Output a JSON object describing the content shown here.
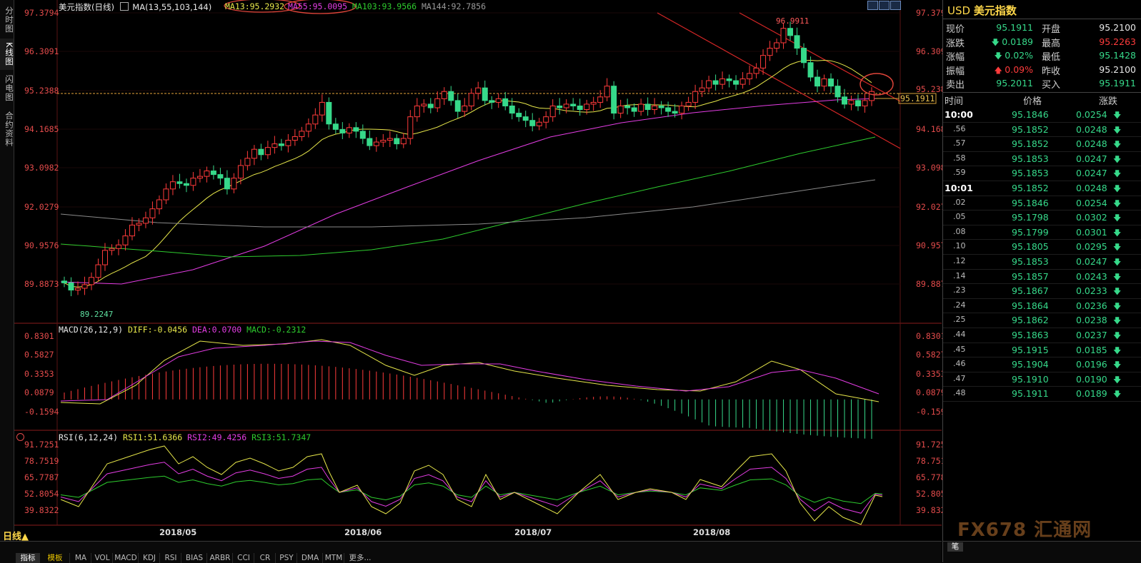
{
  "left_tabs": [
    "分时图",
    "K线图",
    "闪电图",
    "合约资料"
  ],
  "header": {
    "title": "美元指数(日线)",
    "ma_label": "MA(13,55,103,144)",
    "ma13": "MA13:95.2932",
    "ma55": "MA55:95.0095",
    "ma103": "MA103:93.9566",
    "ma144": "MA144:92.7856"
  },
  "price_axis": [
    "97.3794",
    "96.3091",
    "95.2388",
    "94.1685",
    "93.0982",
    "92.0279",
    "90.9576",
    "89.8873"
  ],
  "current_price_tag": "95.1911",
  "high_marker": "96.9911",
  "low_marker": "89.2247",
  "macd": {
    "label": "MACD(26,12,9)",
    "diff": "DIFF:-0.0456",
    "dea": "DEA:0.0700",
    "macd": "MACD:-0.2312",
    "axis": [
      "0.8301",
      "0.5827",
      "0.3353",
      "0.0879",
      "-0.1594"
    ]
  },
  "rsi": {
    "label": "RSI(6,12,24)",
    "rsi1": "RSI1:51.6366",
    "rsi2": "RSI2:49.4256",
    "rsi3": "RSI3:51.7347",
    "axis": [
      "91.7251",
      "78.7519",
      "65.7787",
      "52.8054",
      "39.8322"
    ]
  },
  "date_axis": [
    "2018/05",
    "2018/06",
    "2018/07",
    "2018/08"
  ],
  "bottom": {
    "period": "日线",
    "tab_indicator": "指标",
    "tab_template": "模板",
    "indicators": [
      "MA",
      "VOL",
      "MACD",
      "KDJ",
      "RSI",
      "BIAS",
      "ARBR",
      "CCI",
      "CR",
      "PSY",
      "DMA",
      "MTM",
      "更多..."
    ]
  },
  "side": {
    "code": "USD",
    "name": "美元指数",
    "quotes": [
      {
        "label": "现价",
        "value": "95.1911",
        "label2": "开盘",
        "value2": "95.2100"
      },
      {
        "label": "涨跌",
        "value": "0.0189",
        "label2": "最高",
        "value2": "95.2263"
      },
      {
        "label": "涨幅",
        "value": "0.02%",
        "label2": "最低",
        "value2": "95.1428"
      },
      {
        "label": "振幅",
        "value": "0.09%",
        "label2": "昨收",
        "value2": "95.2100"
      },
      {
        "label": "卖出",
        "value": "95.2011",
        "label2": "买入",
        "value2": "95.1911"
      }
    ],
    "tick_headers": [
      "时间",
      "价格",
      "涨跌"
    ],
    "ticks": [
      {
        "time": "10:00",
        "price": "95.1846",
        "change": "0.0254"
      },
      {
        "time": ".56",
        "price": "95.1852",
        "change": "0.0248"
      },
      {
        "time": ".57",
        "price": "95.1852",
        "change": "0.0248"
      },
      {
        "time": ".58",
        "price": "95.1853",
        "change": "0.0247"
      },
      {
        "time": ".59",
        "price": "95.1853",
        "change": "0.0247"
      },
      {
        "time": "10:01",
        "price": "95.1852",
        "change": "0.0248"
      },
      {
        "time": ".02",
        "price": "95.1846",
        "change": "0.0254"
      },
      {
        "time": ".05",
        "price": "95.1798",
        "change": "0.0302"
      },
      {
        "time": ".08",
        "price": "95.1799",
        "change": "0.0301"
      },
      {
        "time": ".10",
        "price": "95.1805",
        "change": "0.0295"
      },
      {
        "time": ".12",
        "price": "95.1853",
        "change": "0.0247"
      },
      {
        "time": ".14",
        "price": "95.1857",
        "change": "0.0243"
      },
      {
        "time": ".23",
        "price": "95.1867",
        "change": "0.0233"
      },
      {
        "time": ".24",
        "price": "95.1864",
        "change": "0.0236"
      },
      {
        "time": ".25",
        "price": "95.1862",
        "change": "0.0238"
      },
      {
        "time": ".44",
        "price": "95.1863",
        "change": "0.0237"
      },
      {
        "time": ".45",
        "price": "95.1915",
        "change": "0.0185"
      },
      {
        "time": ".46",
        "price": "95.1904",
        "change": "0.0196"
      },
      {
        "time": ".47",
        "price": "95.1910",
        "change": "0.0190"
      },
      {
        "time": ".48",
        "price": "95.1911",
        "change": "0.0189"
      }
    ],
    "footer_tab": "笔",
    "watermark": "FX678 汇通网"
  },
  "colors": {
    "up": "#ff3b3b",
    "down": "#36d98a",
    "ma13": "#e6e64a",
    "ma55": "#e43de4",
    "ma103": "#2ecc2e",
    "ma144": "#8a8a8a",
    "axis_red": "#e34b4b"
  }
}
